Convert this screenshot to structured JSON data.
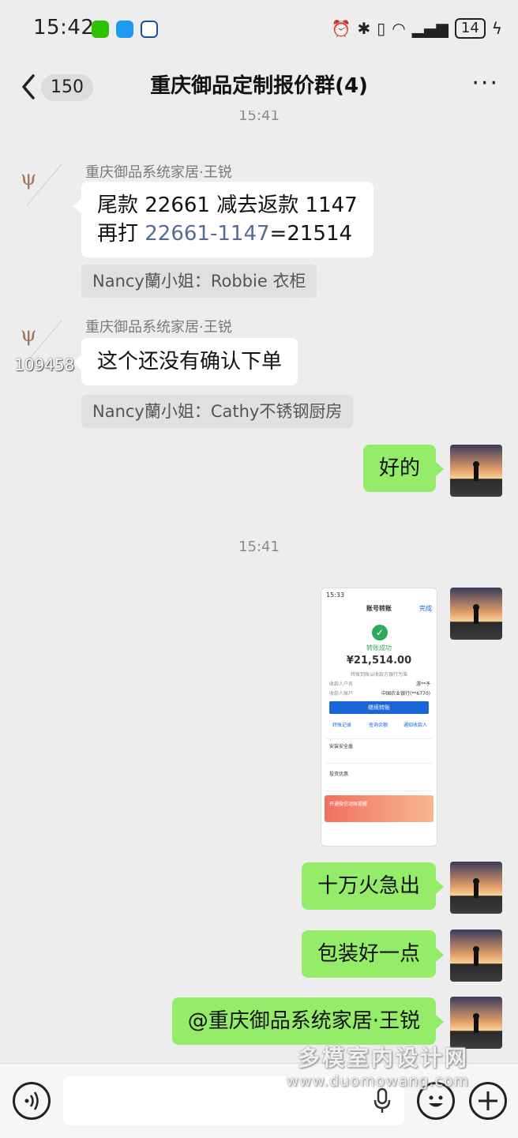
{
  "status_bar": {
    "time": "15:42",
    "battery": "14",
    "icons": [
      "wechat-icon",
      "message-icon",
      "app-icon",
      "alarm-icon",
      "bluetooth-icon",
      "vibrate-icon",
      "wifi-icon",
      "signal-icon",
      "charging-icon"
    ]
  },
  "header": {
    "unread_count": "150",
    "title": "重庆御品定制报价群(4)",
    "more": "···"
  },
  "timestamps": {
    "top_partial": "15:41",
    "middle": "15:41"
  },
  "messages": {
    "m1": {
      "sender": "重庆御品系统家居·王锐",
      "line1": "尾款 22661 减去返款 1147",
      "line2_prefix": "再打 ",
      "line2_link": "22661-1147",
      "line2_suffix": "=21514",
      "quote": "Nancy蘭小姐：Robbie 衣柜"
    },
    "m2": {
      "sender": "重庆御品系统家居·王锐",
      "text": "这个还没有确认下单",
      "quote": "Nancy蘭小姐：Cathy不锈钢厨房",
      "overlay_number": "109458"
    },
    "m3": {
      "text": "好的"
    },
    "m4": {
      "screenshot": {
        "time": "15:33",
        "title": "账号转账",
        "done": "完成",
        "status": "转账成功",
        "amount": "¥21,514.00",
        "note": "转账到账以收款方银行为准",
        "payee_label": "收款人户名",
        "payee": "游**予",
        "account_label": "收款人账户",
        "account": "中国农业银行(**6770)",
        "continue_btn": "继续转账",
        "actions": [
          "转账记录",
          "查询余额",
          "通知收款人"
        ],
        "row1": "安装安全盾",
        "row2": "投资优惠",
        "banner": "开通微信动账提醒"
      }
    },
    "m5": {
      "text": "十万火急出"
    },
    "m6": {
      "text": "包装好一点"
    },
    "m7": {
      "text": "@重庆御品系统家居·王锐"
    }
  },
  "watermark": {
    "line1": "多模室内设计网",
    "line2": "www.duomowang.com"
  },
  "colors": {
    "background": "#ededed",
    "bubble_self": "#95ec69",
    "bubble_other": "#ffffff",
    "link": "#576b95"
  }
}
